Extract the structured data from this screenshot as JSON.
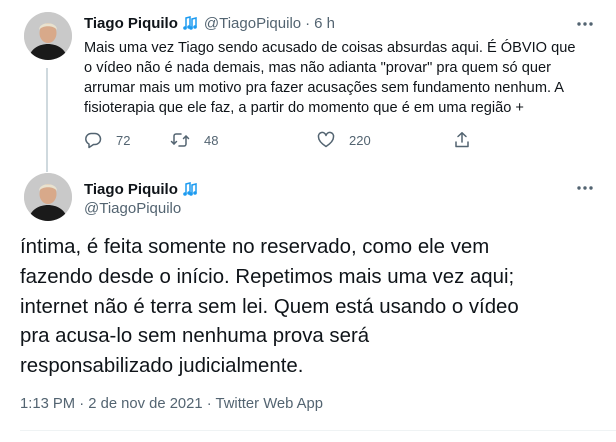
{
  "tweet1": {
    "author_name": "Tiago Piquilo",
    "handle": "@TiagoPiquilo",
    "separator": "·",
    "time": "6 h",
    "text_lines": [
      "Mais uma vez Tiago sendo acusado de coisas absurdas aqui. É ÓBVIO que",
      "o vídeo não é nada demais, mas não adianta \"provar\" pra quem só quer",
      "arrumar mais um motivo pra fazer acusações sem fundamento nenhum. A",
      "fisioterapia que ele faz, a partir do momento que é em uma região +"
    ],
    "reply_count": "72",
    "retweet_count": "48",
    "like_count": "220"
  },
  "tweet2": {
    "author_name": "Tiago Piquilo",
    "handle": "@TiagoPiquilo",
    "text_lines": [
      "íntima, é feita somente no reservado, como ele vem",
      "fazendo desde o início. Repetimos mais uma vez aqui;",
      "internet não é terra sem lei. Quem está usando o vídeo",
      "pra acusa-lo sem nenhuma prova será",
      "responsabilizado judicialmente."
    ],
    "meta": "1:13 PM · 2 de nov de 2021 · Twitter Web App"
  },
  "icons": {
    "verified": "music-notes-icon",
    "more": "more-horizontal-icon",
    "reply": "reply-bubble-icon",
    "retweet": "retweet-icon",
    "like": "heart-icon",
    "share": "share-icon"
  },
  "colors": {
    "text_primary": "#0f1419",
    "text_secondary": "#536471",
    "verified_blue": "#1d9bf0",
    "thread_line": "#cfd9de"
  }
}
